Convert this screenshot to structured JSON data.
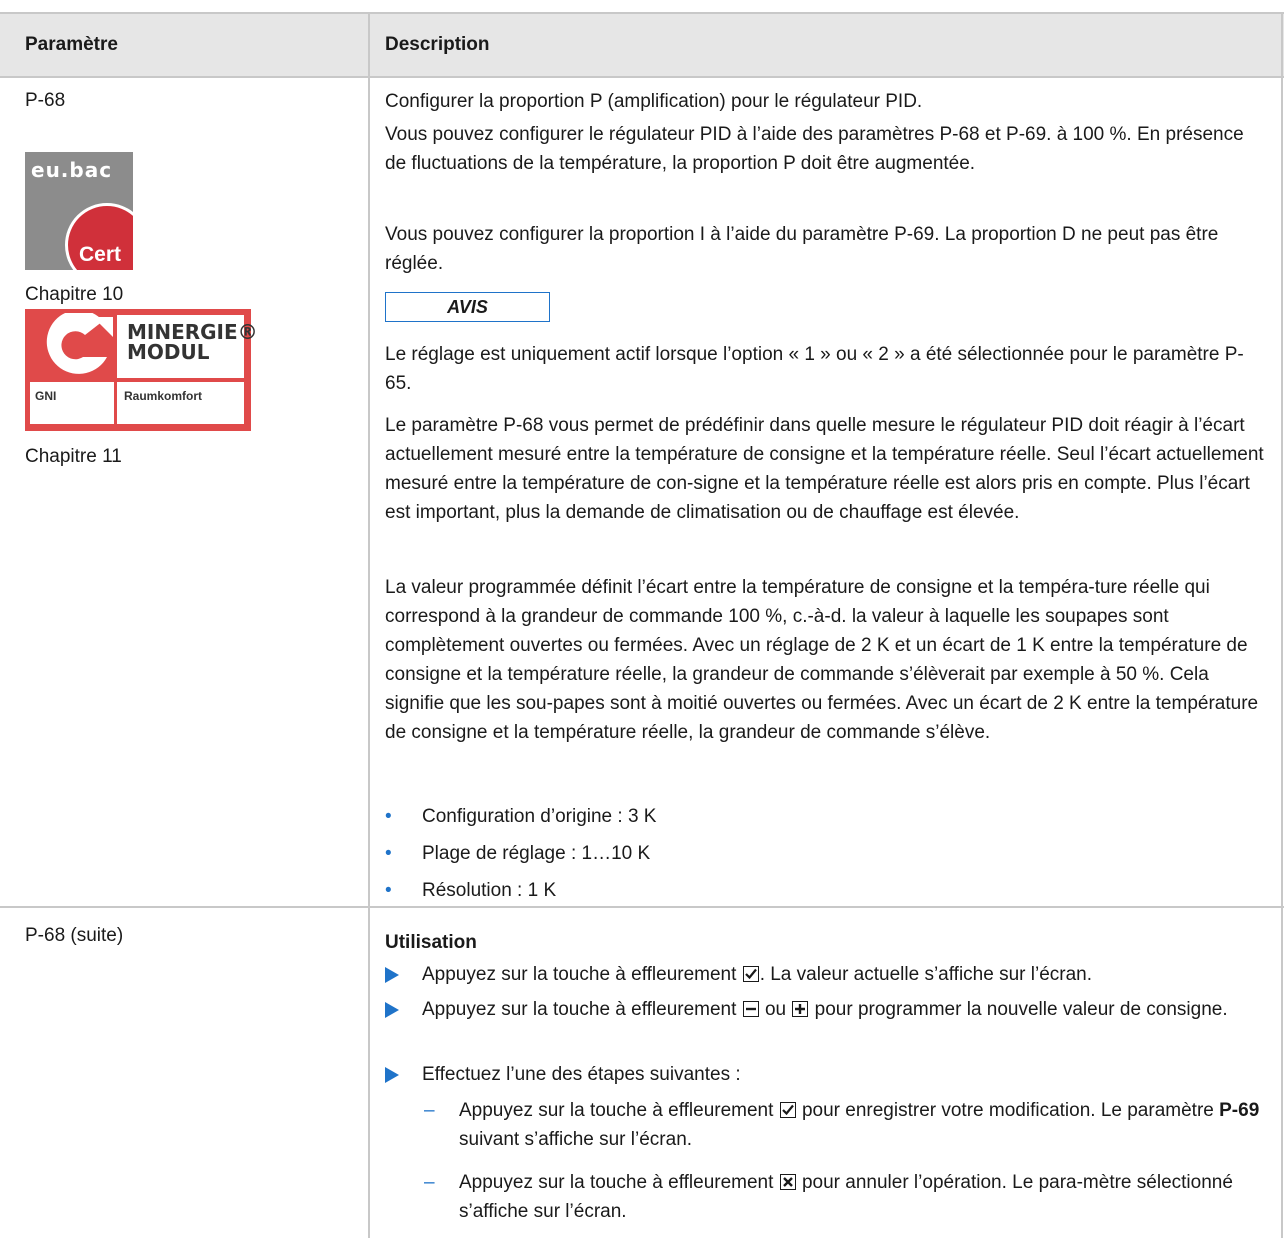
{
  "header": {
    "col1": "Paramètre",
    "col2": "Description"
  },
  "row1": {
    "param": "P-68",
    "logo_eubac": {
      "label": "eu.bac",
      "cert": "Cert"
    },
    "chapter1": "Chapitre 10",
    "logo_minergie": {
      "line1": "MINERGIE®",
      "line2": "MODUL",
      "cell1": "GNI",
      "cell2": "Raumkomfort"
    },
    "chapter2": "Chapitre 11",
    "p1": "Configurer la proportion P (amplification) pour le régulateur PID.",
    "p2": "Vous pouvez configurer le régulateur PID à l’aide des paramètres P-68 et P-69. à 100 %. En présence de fluctuations de la température, la proportion P doit être augmentée.",
    "p3": "Vous pouvez configurer la proportion I à l’aide du paramètre P-69. La proportion D ne peut pas être réglée.",
    "avis": "AVIS",
    "p4": "Le réglage est uniquement actif lorsque l’option « 1 » ou « 2 » a été sélectionnée pour le paramètre P-65.",
    "p5": "Le paramètre P-68 vous permet de prédéfinir dans quelle mesure le régulateur PID doit réagir à l’écart actuellement mesuré entre la température de consigne et la température réelle. Seul l’écart actuellement mesuré entre la température de con-signe et la température réelle est alors pris en compte. Plus l’écart est important, plus la demande de climatisation ou de chauffage est élevée.",
    "p6": "La valeur programmée définit l’écart entre la température de consigne et la tempéra-ture réelle qui correspond à la grandeur de commande 100 %, c.-à-d. la valeur à laquelle les soupapes sont complètement ouvertes ou fermées. Avec un réglage de 2 K et un écart de 1 K entre la température de consigne et la température réelle, la grandeur de commande s’élèverait par exemple à 50 %. Cela signifie que les sou-papes sont à moitié ouvertes ou fermées. Avec un écart de 2 K entre la température de consigne et la température réelle, la grandeur de commande s’élève.",
    "bullets": [
      "Configuration d’origine : 3 K",
      "Plage de réglage : 1…10 K",
      "Résolution : 1 K"
    ]
  },
  "row2": {
    "param": "P-68 (suite)",
    "heading": "Utilisation",
    "step1_a": "Appuyez sur la touche à effleurement ",
    "step1_b": ". La valeur actuelle s’affiche sur l’écran.",
    "step2_a": "Appuyez sur la touche à effleurement ",
    "step2_b": " ou ",
    "step2_c": " pour programmer la nouvelle valeur de consigne.",
    "step3": "Effectuez l’une des étapes suivantes :",
    "sub1_a": "Appuyez sur la touche à effleurement ",
    "sub1_b": " pour enregistrer votre modification. Le paramètre ",
    "sub1_bold": "P-69",
    "sub1_c": " suivant s’affiche sur l’écran.",
    "sub2_a": "Appuyez sur la touche à effleurement ",
    "sub2_b": " pour annuler l’opération. Le para-mètre sélectionné s’affiche sur l’écran."
  }
}
